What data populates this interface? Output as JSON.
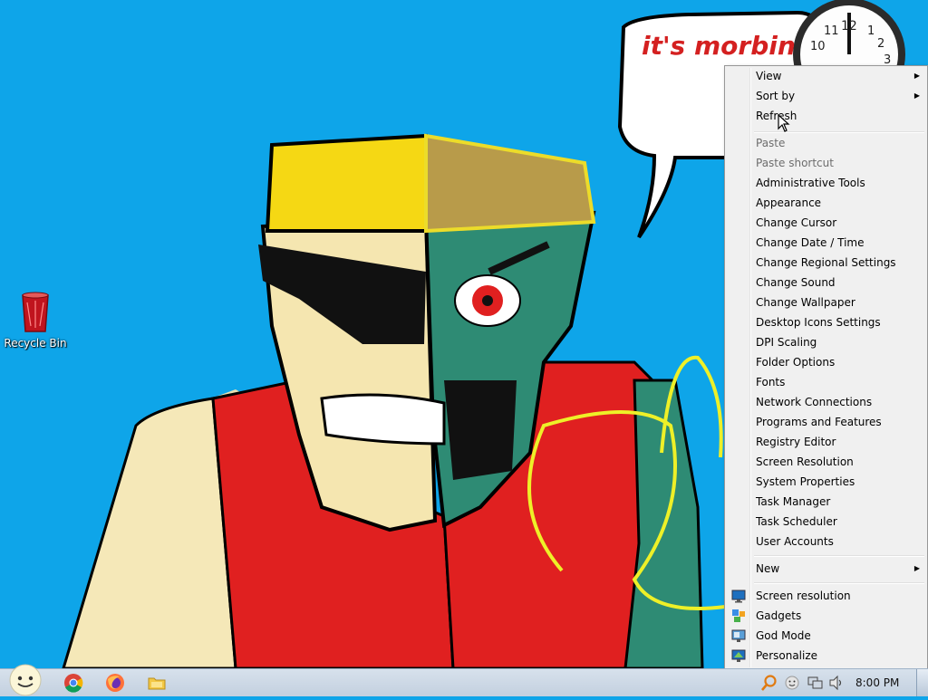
{
  "desktop": {
    "icons": [
      {
        "label": "Recycle Bin",
        "icon": "recycle-bin-icon"
      }
    ],
    "wallpaper": {
      "speech_text": "it's morbin",
      "clock_numbers": [
        "10",
        "11",
        "12",
        "1",
        "2",
        "3"
      ]
    }
  },
  "context_menu": {
    "items": [
      {
        "label": "View",
        "submenu": true
      },
      {
        "label": "Sort by",
        "submenu": true
      },
      {
        "label": "Refresh"
      },
      {
        "label": "Paste",
        "disabled": true
      },
      {
        "label": "Paste shortcut",
        "disabled": true
      },
      {
        "label": "Administrative Tools"
      },
      {
        "label": "Appearance"
      },
      {
        "label": "Change Cursor"
      },
      {
        "label": "Change Date / Time"
      },
      {
        "label": "Change Regional Settings"
      },
      {
        "label": "Change Sound"
      },
      {
        "label": "Change Wallpaper"
      },
      {
        "label": "Desktop Icons Settings"
      },
      {
        "label": "DPI Scaling"
      },
      {
        "label": "Folder Options"
      },
      {
        "label": "Fonts"
      },
      {
        "label": "Network Connections"
      },
      {
        "label": "Programs and Features"
      },
      {
        "label": "Registry Editor"
      },
      {
        "label": "Screen Resolution"
      },
      {
        "label": "System Properties"
      },
      {
        "label": "Task Manager"
      },
      {
        "label": "Task Scheduler"
      },
      {
        "label": "User Accounts"
      },
      {
        "label": "New",
        "submenu": true
      },
      {
        "label": "Screen resolution",
        "icon": "monitor-icon"
      },
      {
        "label": "Gadgets",
        "icon": "gadgets-icon"
      },
      {
        "label": "God Mode",
        "icon": "god-mode-icon"
      },
      {
        "label": "Personalize",
        "icon": "personalize-icon"
      }
    ]
  },
  "taskbar": {
    "start": {
      "icon": "start-orb-icon"
    },
    "pinned": [
      {
        "name": "chrome",
        "icon": "chrome-icon"
      },
      {
        "name": "firefox",
        "icon": "firefox-icon"
      },
      {
        "name": "explorer",
        "icon": "folder-icon"
      }
    ],
    "tray": [
      {
        "name": "search",
        "icon": "search-icon"
      },
      {
        "name": "emoji",
        "icon": "smiley-icon"
      },
      {
        "name": "network",
        "icon": "network-icon"
      },
      {
        "name": "volume",
        "icon": "speaker-icon"
      }
    ],
    "clock": "8:00 PM"
  },
  "colors": {
    "desktop_bg": "#0ea5e9",
    "menu_bg": "#f0f0f0",
    "speech_text": "#d42020"
  }
}
